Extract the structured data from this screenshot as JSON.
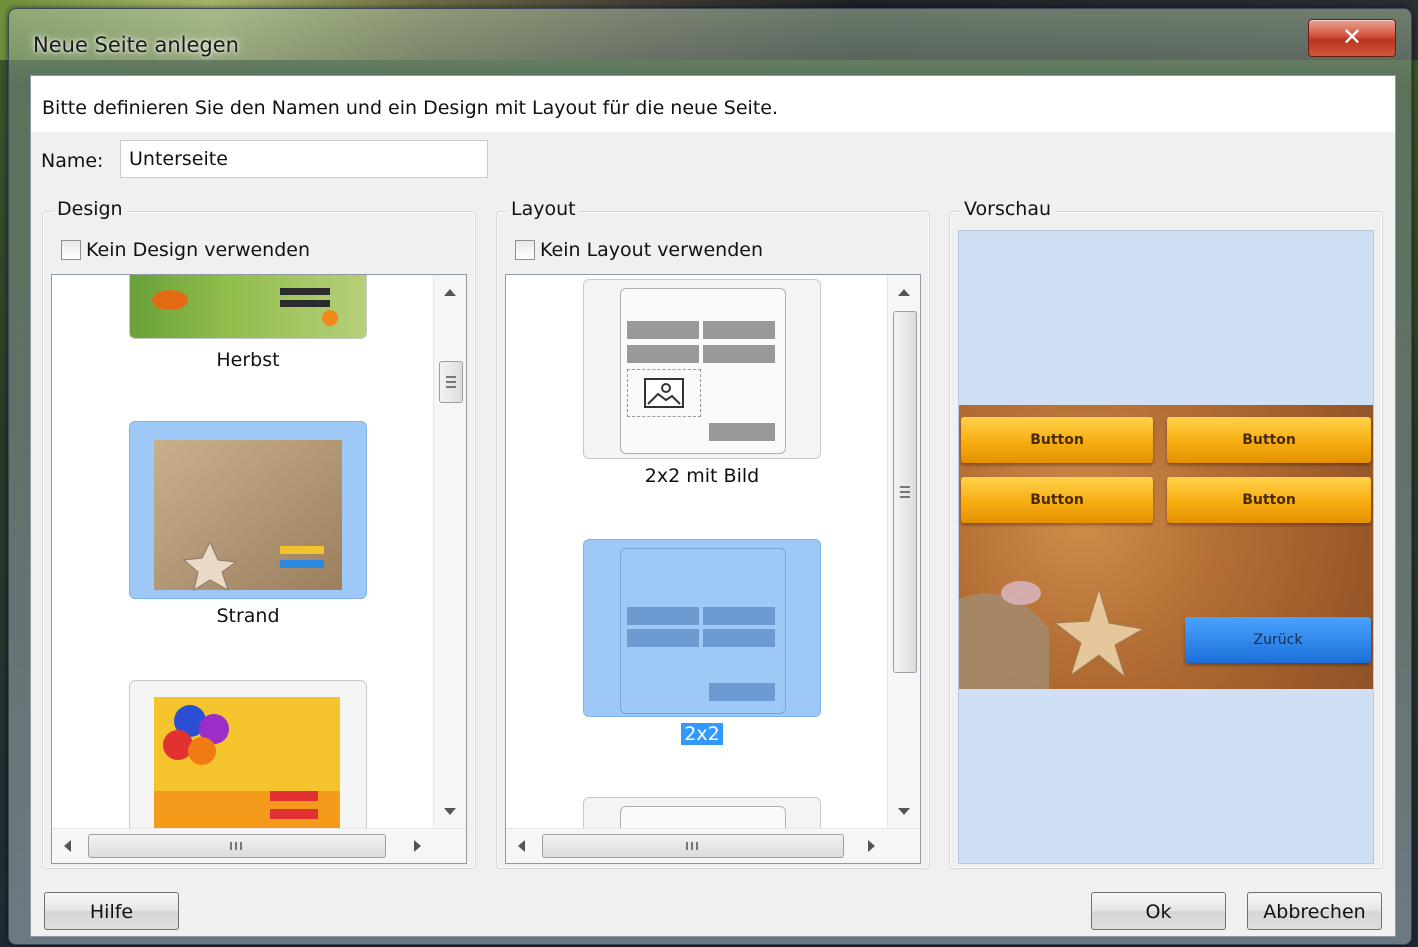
{
  "window": {
    "title": "Neue Seite anlegen",
    "close_glyph": "✕"
  },
  "info": "Bitte definieren Sie den Namen und ein Design mit Layout für die neue Seite.",
  "name_field": {
    "label": "Name:",
    "value": "Unterseite"
  },
  "design": {
    "group_title": "Design",
    "no_design_label": "Kein Design verwenden",
    "items": [
      {
        "label": "Herbst"
      },
      {
        "label": "Strand"
      }
    ]
  },
  "layout": {
    "group_title": "Layout",
    "no_layout_label": "Kein Layout verwenden",
    "items": [
      {
        "label": "2x2 mit Bild"
      },
      {
        "label": "2x2"
      }
    ]
  },
  "preview": {
    "group_title": "Vorschau",
    "buttons": [
      "Button",
      "Button",
      "Button",
      "Button"
    ],
    "back_button": "Zurück"
  },
  "footer": {
    "help": "Hilfe",
    "ok": "Ok",
    "cancel": "Abbrechen"
  },
  "icons": {
    "image_placeholder": "image-icon",
    "starfish": "starfish-icon"
  },
  "colors": {
    "selection": "#3399ff",
    "selected_card": "#9ec9f6",
    "preview_bg": "#cfe0f5"
  }
}
